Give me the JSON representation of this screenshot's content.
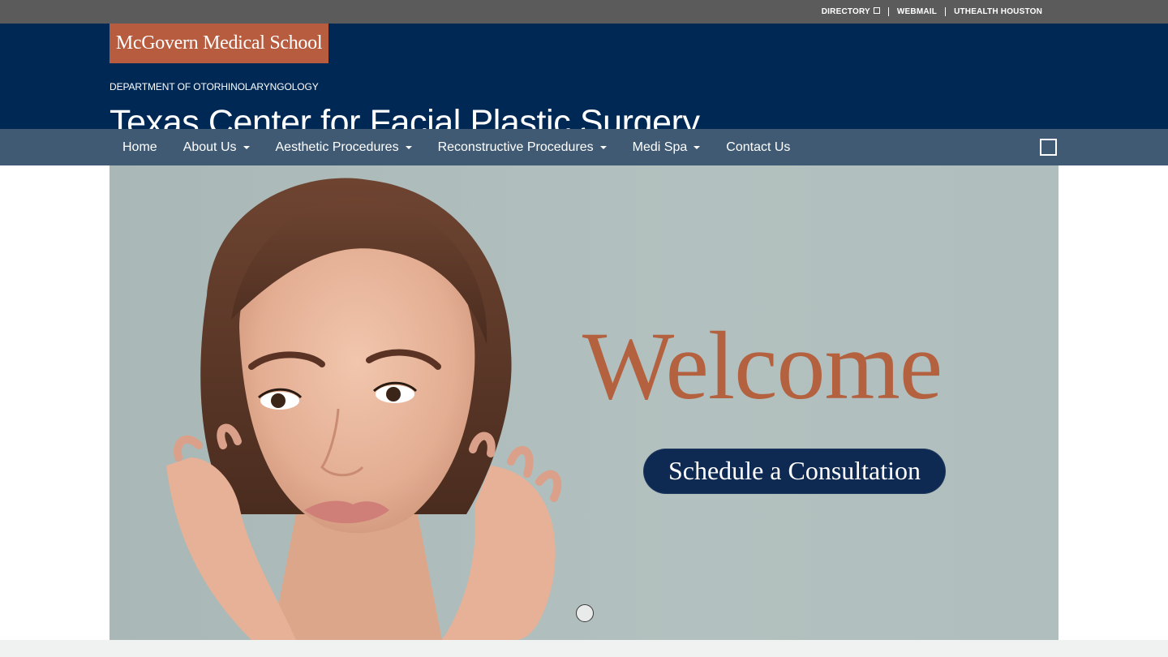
{
  "utility": {
    "links": [
      {
        "label": "DIRECTORY",
        "icon": "external-link-icon"
      },
      {
        "label": "WEBMAIL"
      },
      {
        "label": "UTHEALTH HOUSTON"
      }
    ]
  },
  "header": {
    "logo": "McGovern Medical School",
    "department": "DEPARTMENT OF OTORHINOLARYNGOLOGY",
    "site_title": "Texas Center for Facial Plastic Surgery"
  },
  "nav": {
    "items": [
      {
        "label": "Home",
        "dropdown": false
      },
      {
        "label": "About Us",
        "dropdown": true
      },
      {
        "label": "Aesthetic Procedures",
        "dropdown": true
      },
      {
        "label": "Reconstructive Procedures",
        "dropdown": true
      },
      {
        "label": "Medi Spa",
        "dropdown": true
      },
      {
        "label": "Contact Us",
        "dropdown": false
      }
    ],
    "search_icon": "square-icon"
  },
  "hero": {
    "welcome": "Welcome",
    "cta_label": "Schedule a Consultation",
    "slide_count": 1,
    "active_slide": 1
  },
  "colors": {
    "utility_bar": "#5b5b5b",
    "header": "#002855",
    "navbar": "#3f5a72",
    "logo_bg": "#b85c3f",
    "welcome_text": "#b4613f",
    "cta_bg": "#0e2a52",
    "hero_bg": "#afbdbc"
  }
}
